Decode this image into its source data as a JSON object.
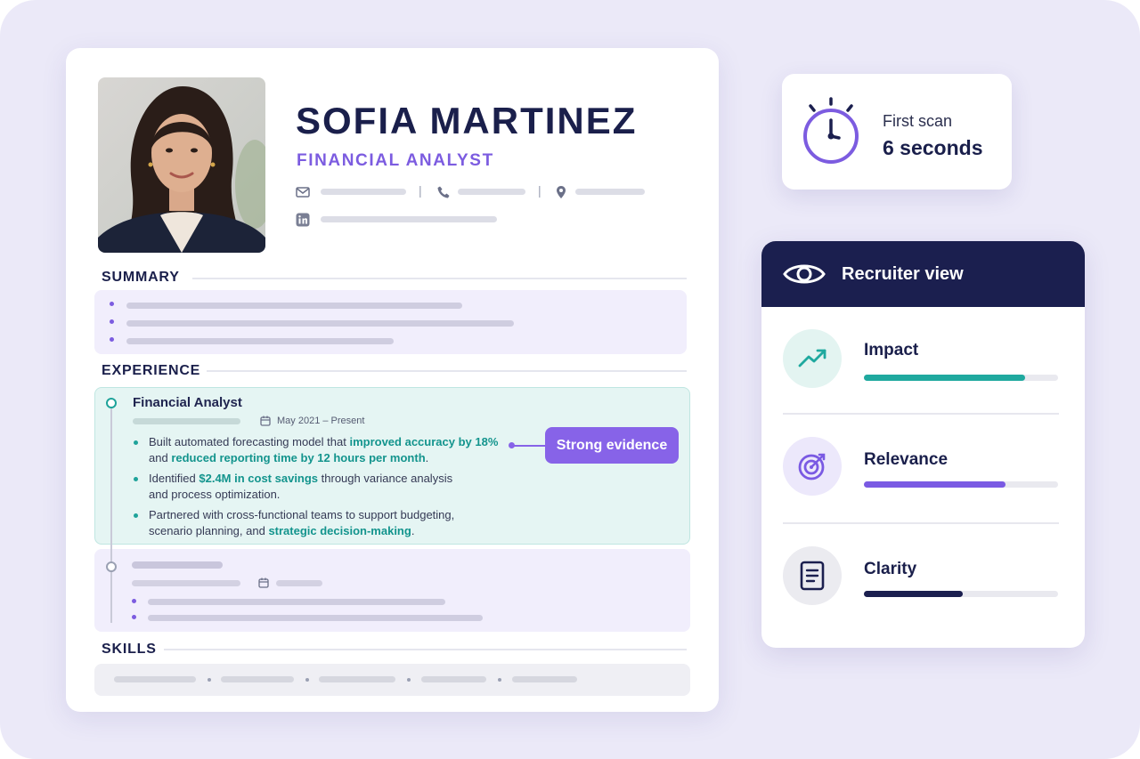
{
  "resume": {
    "name": "SOFIA MARTINEZ",
    "role": "FINANCIAL ANALYST",
    "sections": {
      "summary": "SUMMARY",
      "experience": "EXPERIENCE",
      "skills": "SKILLS"
    },
    "experience": {
      "job_title": "Financial Analyst",
      "date": "May 2021 – Present",
      "bullets": [
        {
          "parts": [
            {
              "text": "Built automated forecasting model that ",
              "highlight": false
            },
            {
              "text": "improved accuracy by 18%",
              "highlight": true
            },
            {
              "text": " and ",
              "highlight": false
            },
            {
              "text": "reduced reporting time by 12 hours per month",
              "highlight": true
            },
            {
              "text": ".",
              "highlight": false
            }
          ]
        },
        {
          "parts": [
            {
              "text": "Identified ",
              "highlight": false
            },
            {
              "text": "$2.4M in cost savings",
              "highlight": true
            },
            {
              "text": " through variance analysis and process optimization.",
              "highlight": false
            }
          ]
        },
        {
          "parts": [
            {
              "text": "Partnered with cross-functional teams to support budgeting, scenario planning, and ",
              "highlight": false
            },
            {
              "text": "strategic decision-making",
              "highlight": true
            },
            {
              "text": ".",
              "highlight": false
            }
          ]
        }
      ],
      "callout": "Strong evidence"
    }
  },
  "scan": {
    "label": "First scan",
    "value": "6 seconds",
    "icon": "stopwatch-icon"
  },
  "recruiter": {
    "title": "Recruiter view",
    "icon": "eye-icon",
    "metrics": [
      {
        "label": "Impact",
        "icon": "trend-up-icon",
        "level": 0.83,
        "color": "#1fa99f",
        "bg": "#e3f4f1"
      },
      {
        "label": "Relevance",
        "icon": "target-icon",
        "level": 0.73,
        "color": "#7a5ae3",
        "bg": "#ece8fb"
      },
      {
        "label": "Clarity",
        "icon": "document-icon",
        "level": 0.51,
        "color": "#1b1f4f",
        "bg": "#ebebf0"
      }
    ]
  },
  "colors": {
    "accent": "#7c5ce0",
    "teal": "#13948d",
    "navy": "#1b1f4f",
    "background": "#ebe9f8"
  }
}
